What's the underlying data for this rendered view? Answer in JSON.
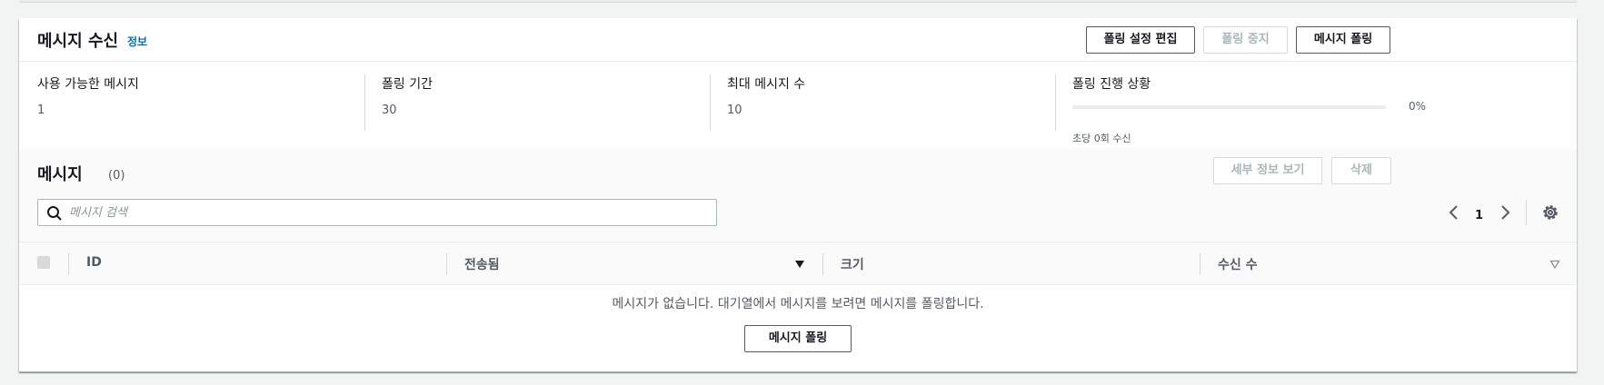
{
  "header": {
    "title": "메시지 수신",
    "info_link": "정보",
    "buttons": {
      "edit_poll_settings": "폴링 설정 편집",
      "stop_polling": "폴링 중지",
      "poll_messages": "메시지 폴링"
    }
  },
  "stats": {
    "available_messages": {
      "label": "사용 가능한 메시지",
      "value": "1"
    },
    "polling_duration": {
      "label": "폴링 기간",
      "value": "30"
    },
    "max_messages": {
      "label": "최대 메시지 수",
      "value": "10"
    },
    "polling_progress": {
      "label": "폴링 진행 상황",
      "percent_text": "0%",
      "progress_fraction": 0,
      "description": "초당 0회 수신"
    }
  },
  "messages": {
    "title": "메시지",
    "count": "(0)",
    "buttons": {
      "view_details": "세부 정보 보기",
      "delete": "삭제"
    },
    "search": {
      "placeholder": "메시지 검색",
      "value": ""
    },
    "pagination": {
      "current_page": "1"
    },
    "columns": [
      "ID",
      "전송됨",
      "크기",
      "수신 수"
    ],
    "empty_message": "메시지가 없습니다. 대기열에서 메시지를 보려면 메시지를 폴링합니다.",
    "empty_poll_button": "메시지 폴링"
  },
  "icons": {
    "search": "search-icon",
    "prev_page": "chevron-left-icon",
    "next_page": "chevron-right-icon",
    "settings": "gear-icon",
    "sort_desc": "caret-down-filled-icon",
    "sort_none": "caret-down-outline-icon"
  },
  "colors": {
    "link": "#0073bb",
    "text_primary": "#16191f",
    "text_secondary": "#545b64",
    "disabled": "#aab7b8"
  }
}
